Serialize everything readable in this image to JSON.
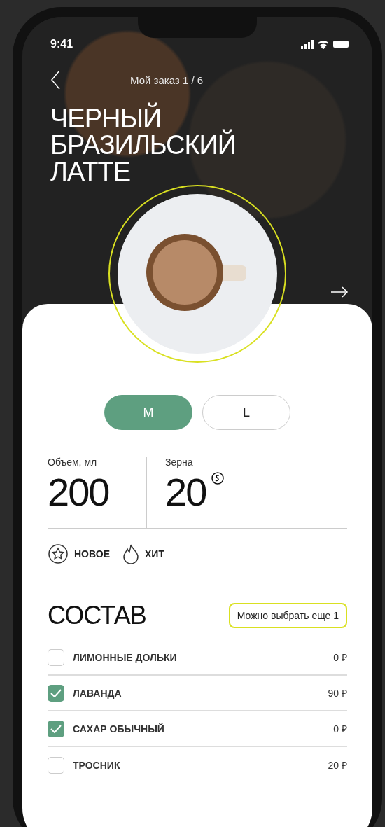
{
  "status_bar": {
    "time": "9:41"
  },
  "header": {
    "title": "Мой заказ 1 / 6"
  },
  "product": {
    "name": "ЧЕРНЫЙ БРАЗИЛЬСКИЙ ЛАТТЕ"
  },
  "sizes": [
    {
      "label": "М",
      "selected": true
    },
    {
      "label": "L",
      "selected": false
    }
  ],
  "stats": [
    {
      "label": "Объем, мл",
      "value": "200",
      "kind": "plain"
    },
    {
      "label": "Зерна",
      "value": "20",
      "kind": "coins"
    }
  ],
  "tags": [
    {
      "label": "НОВОЕ",
      "kind": "star"
    },
    {
      "label": "ХИТ",
      "kind": "flame"
    }
  ],
  "composition": {
    "title": "СОСТАВ",
    "hint": "Можно выбрать еще 1",
    "items": [
      {
        "name": "ЛИМОННЫЕ ДОЛЬКИ",
        "price": "0 ₽",
        "checked": false
      },
      {
        "name": "ЛАВАНДА",
        "price": "90 ₽",
        "checked": true
      },
      {
        "name": "САХАР ОБЫЧНЫЙ",
        "price": "0 ₽",
        "checked": true
      },
      {
        "name": "ТРОСНИК",
        "price": "20 ₽",
        "checked": false
      }
    ]
  }
}
